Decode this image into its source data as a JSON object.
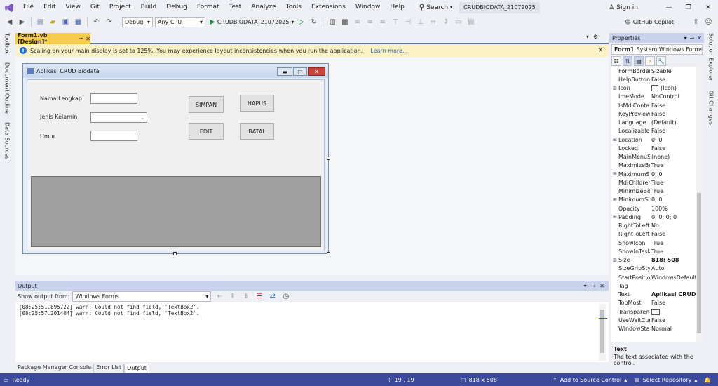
{
  "menu": [
    "File",
    "Edit",
    "View",
    "Git",
    "Project",
    "Build",
    "Debug",
    "Format",
    "Test",
    "Analyze",
    "Tools",
    "Extensions",
    "Window",
    "Help"
  ],
  "search": {
    "label": "Search",
    "icon": "search-icon"
  },
  "solution_badge": "CRUDBIODATA_21072025",
  "signin": "Sign in",
  "copilot": "GitHub Copilot",
  "toolbar": {
    "config": "Debug",
    "platform": "Any CPU",
    "start_label": "CRUDBIODATA_21072025"
  },
  "left_tabs": [
    "Toolbox",
    "Document Outline",
    "Data Sources"
  ],
  "right_tabs": [
    "Solution Explorer",
    "Git Changes"
  ],
  "doc_tab": {
    "label": "Form1.vb [Design]*"
  },
  "infobar": {
    "message": "Scaling on your main display is set to 125%. You may experience layout inconsistencies when you run the application.",
    "link": "Learn more..."
  },
  "form": {
    "title": "Aplikasi CRUD Biodata",
    "labels": {
      "nama": "Nama Lengkap",
      "jenis": "Jenis Kelamin",
      "umur": "Umur"
    },
    "buttons": {
      "simpan": "SIMPAN",
      "hapus": "HAPUS",
      "edit": "EDIT",
      "batal": "BATAL"
    }
  },
  "output": {
    "title": "Output",
    "show_from_label": "Show output from:",
    "source": "Windows Forms",
    "lines": [
      "[08:25:51.895722] warn: Could not find field, 'TextBox2'.",
      "[08:25:57.201404] warn: Could not find field, 'TextBox2'."
    ],
    "tabs": [
      "Package Manager Console",
      "Error List",
      "Output"
    ]
  },
  "properties": {
    "title": "Properties",
    "object_name": "Form1",
    "object_type": "System.Windows.Forms.F",
    "rows": [
      {
        "exp": "",
        "name": "FormBorderStyle",
        "value": "Sizable",
        "bold": false
      },
      {
        "exp": "",
        "name": "HelpButton",
        "value": "False",
        "bold": false
      },
      {
        "exp": "⊞",
        "name": "Icon",
        "value": "(Icon)",
        "bold": false
      },
      {
        "exp": "",
        "name": "ImeMode",
        "value": "NoControl",
        "bold": false
      },
      {
        "exp": "",
        "name": "IsMdiContainer",
        "value": "False",
        "bold": false
      },
      {
        "exp": "",
        "name": "KeyPreview",
        "value": "False",
        "bold": false
      },
      {
        "exp": "",
        "name": "Language",
        "value": "(Default)",
        "bold": false
      },
      {
        "exp": "",
        "name": "Localizable",
        "value": "False",
        "bold": false
      },
      {
        "exp": "⊞",
        "name": "Location",
        "value": "0; 0",
        "bold": false
      },
      {
        "exp": "",
        "name": "Locked",
        "value": "False",
        "bold": false
      },
      {
        "exp": "",
        "name": "MainMenuStrip",
        "value": "(none)",
        "bold": false
      },
      {
        "exp": "",
        "name": "MaximizeBox",
        "value": "True",
        "bold": false
      },
      {
        "exp": "⊞",
        "name": "MaximumSize",
        "value": "0; 0",
        "bold": false
      },
      {
        "exp": "",
        "name": "MdiChildrenMinimizedAnchorBottom",
        "value": "True",
        "bold": false
      },
      {
        "exp": "",
        "name": "MinimizeBox",
        "value": "True",
        "bold": false
      },
      {
        "exp": "⊞",
        "name": "MinimumSize",
        "value": "0; 0",
        "bold": false
      },
      {
        "exp": "",
        "name": "Opacity",
        "value": "100%",
        "bold": false
      },
      {
        "exp": "⊞",
        "name": "Padding",
        "value": "0; 0; 0; 0",
        "bold": false
      },
      {
        "exp": "",
        "name": "RightToLeft",
        "value": "No",
        "bold": false
      },
      {
        "exp": "",
        "name": "RightToLeftLayout",
        "value": "False",
        "bold": false
      },
      {
        "exp": "",
        "name": "ShowIcon",
        "value": "True",
        "bold": false
      },
      {
        "exp": "",
        "name": "ShowInTaskbar",
        "value": "True",
        "bold": false
      },
      {
        "exp": "⊞",
        "name": "Size",
        "value": "818; 508",
        "bold": true
      },
      {
        "exp": "",
        "name": "SizeGripStyle",
        "value": "Auto",
        "bold": false
      },
      {
        "exp": "",
        "name": "StartPosition",
        "value": "WindowsDefaultLocation",
        "bold": false
      },
      {
        "exp": "",
        "name": "Tag",
        "value": "",
        "bold": false
      },
      {
        "exp": "",
        "name": "Text",
        "value": "Aplikasi CRUD Biodata",
        "bold": true
      },
      {
        "exp": "",
        "name": "TopMost",
        "value": "False",
        "bold": false
      },
      {
        "exp": "",
        "name": "TransparencyKey",
        "value": "",
        "bold": false
      },
      {
        "exp": "",
        "name": "UseWaitCursor",
        "value": "False",
        "bold": false
      },
      {
        "exp": "",
        "name": "WindowState",
        "value": "Normal",
        "bold": false
      }
    ],
    "desc_title": "Text",
    "desc_body": "The text associated with the control."
  },
  "status": {
    "ready": "Ready",
    "position": "19 , 19",
    "size": "818 x 508",
    "source_control": "Add to Source Control",
    "repo": "Select Repository"
  },
  "colors": {
    "accent": "#3b4a9b",
    "tab_active": "#f5cd4b",
    "info_bg": "#fcf0c5"
  }
}
